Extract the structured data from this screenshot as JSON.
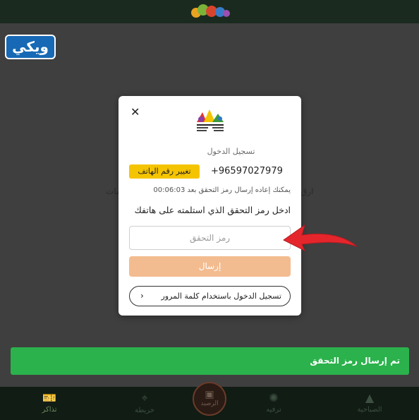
{
  "background": {
    "text_left": "ارق",
    "text_right": "مات"
  },
  "watermark": {
    "label": "ويكي"
  },
  "modal": {
    "title": "تسجيل الدخول",
    "phone": "+96597027979",
    "change_phone_label": "تغيير رقم الهاتف",
    "resend_text": "يمكنك إعاده إرسال رمز التحقق بعد 00:06:03",
    "prompt": "ادخل رمز التحقق الذي استلمته على هاتفك",
    "code_placeholder": "رمز التحقق",
    "send_label": "إرسال",
    "password_login_label": "تسجيل الدخول باستخدام كلمة المرور",
    "chevron": "›"
  },
  "toast": {
    "text": "تم إرسال رمز التحقق"
  },
  "nav": {
    "tickets": "تذاكر",
    "map": "خريطة",
    "wallet": "الرصيد",
    "entertainment": "ترفيه",
    "morning": "الصباحية"
  },
  "colors": {
    "accent_yellow": "#f5c400",
    "send_button": "#f3bc90",
    "toast_green": "#2bb24c",
    "arrow_red": "#e4262c",
    "watermark_blue": "#1769b5"
  },
  "icons": {
    "close": "close-icon",
    "chevron": "chevron-left-icon",
    "tickets": "ticket-icon",
    "map": "map-pin-icon",
    "wallet": "wallet-icon",
    "entertainment": "ferris-wheel-icon",
    "morning": "mountain-icon"
  }
}
